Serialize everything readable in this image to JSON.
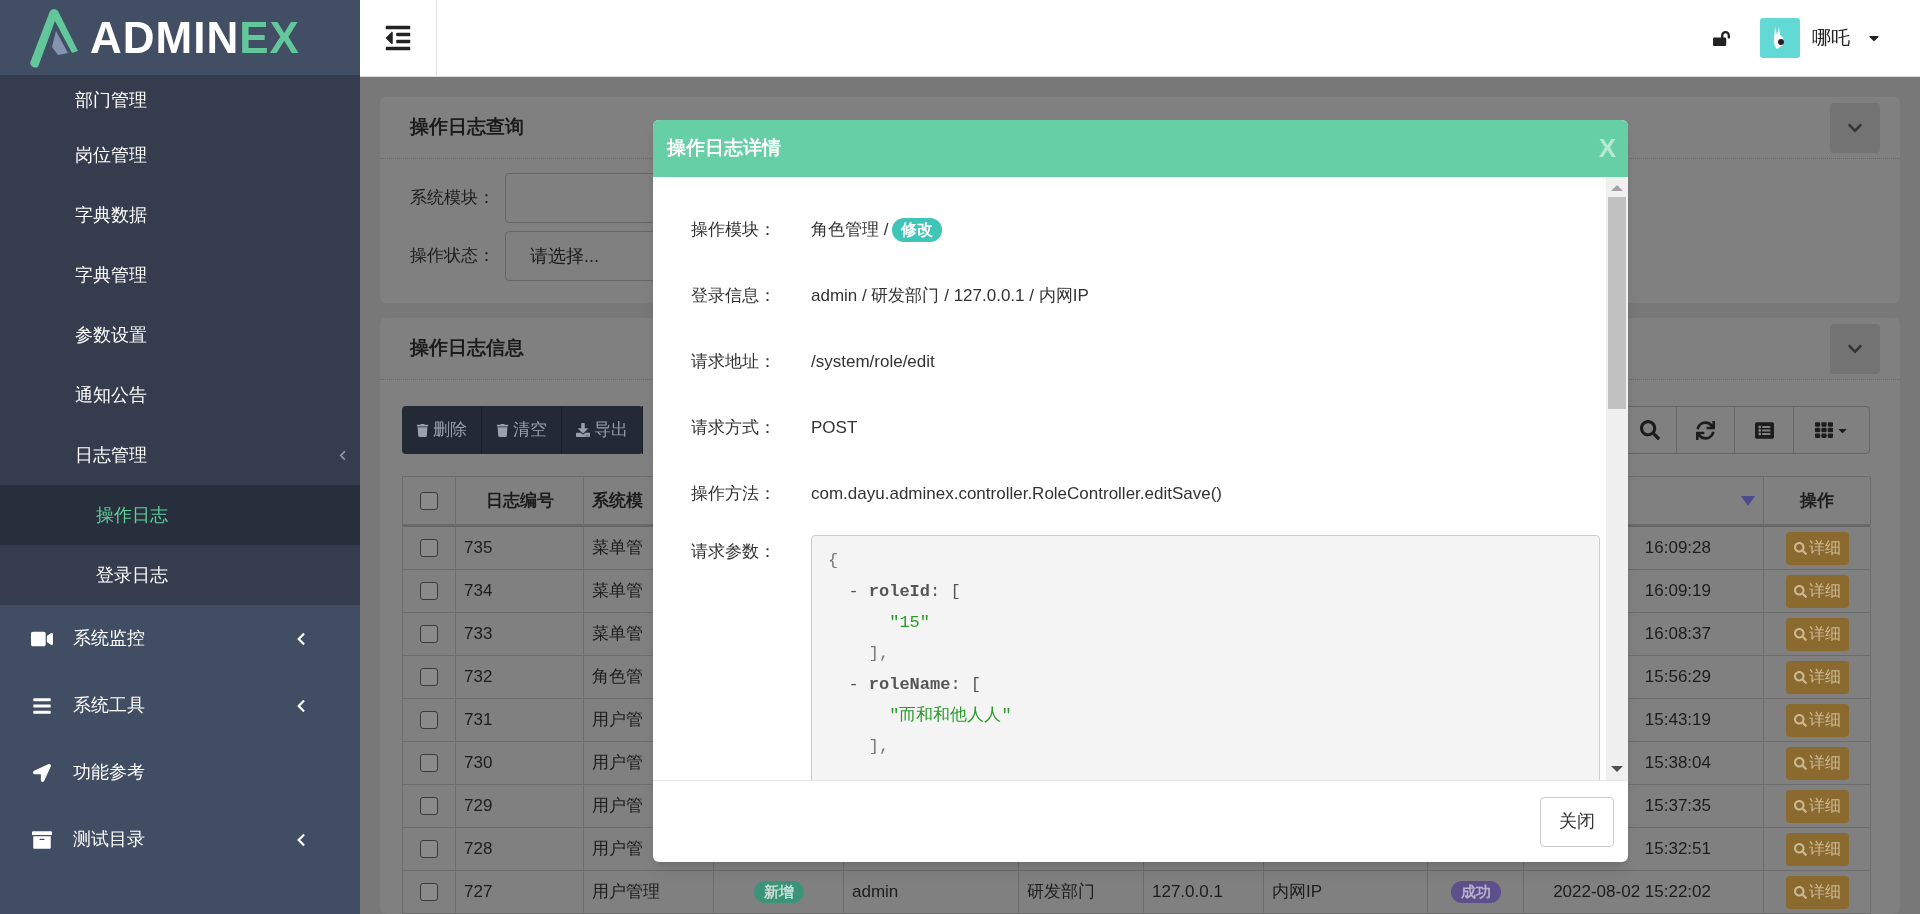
{
  "logo": {
    "text_main": "ADMIN",
    "text_accent": "EX"
  },
  "header": {
    "username": "哪吒"
  },
  "sidebar": {
    "items": [
      {
        "label": "部门管理",
        "selected": false
      },
      {
        "label": "岗位管理",
        "selected": false
      },
      {
        "label": "字典数据",
        "selected": false
      },
      {
        "label": "字典管理",
        "selected": false
      },
      {
        "label": "参数设置",
        "selected": false
      },
      {
        "label": "通知公告",
        "selected": false
      },
      {
        "label": "日志管理",
        "selected": false,
        "expanded": true,
        "children": [
          {
            "label": "操作日志",
            "selected": true
          },
          {
            "label": "登录日志",
            "selected": false
          }
        ]
      }
    ],
    "groups": [
      {
        "label": "系统监控",
        "expanded": false
      },
      {
        "label": "系统工具",
        "expanded": false
      },
      {
        "label": "功能参考"
      },
      {
        "label": "测试目录",
        "expanded": false
      }
    ]
  },
  "query_panel": {
    "title": "操作日志查询",
    "fields": [
      {
        "label": "系统模块：",
        "kind": "input"
      },
      {
        "label": "操作状态：",
        "kind": "select",
        "value": "请选择..."
      }
    ]
  },
  "list_panel": {
    "title": "操作日志信息",
    "actions": [
      "删除",
      "清空",
      "导出"
    ],
    "table": {
      "header": {
        "checked": false,
        "id": "日志编号",
        "module": "系统模",
        "action": "操作"
      },
      "rows": [
        {
          "checked": false,
          "id": "735",
          "module": "菜单管",
          "time": "16:09:28",
          "action": "详细"
        },
        {
          "checked": false,
          "id": "734",
          "module": "菜单管",
          "time": "16:09:19",
          "action": "详细"
        },
        {
          "checked": false,
          "id": "733",
          "module": "菜单管",
          "time": "16:08:37",
          "action": "详细"
        },
        {
          "checked": false,
          "id": "732",
          "module": "角色管",
          "time": "15:56:29",
          "action": "详细"
        },
        {
          "checked": false,
          "id": "731",
          "module": "用户管",
          "time": "15:43:19",
          "action": "详细"
        },
        {
          "checked": false,
          "id": "730",
          "module": "用户管",
          "time": "15:38:04",
          "action": "详细"
        },
        {
          "checked": false,
          "id": "729",
          "module": "用户管",
          "time": "15:37:35",
          "action": "详细"
        },
        {
          "checked": false,
          "id": "728",
          "module": "用户管",
          "time": "15:32:51",
          "action": "详细"
        },
        {
          "checked": false,
          "id": "727",
          "module": "用户管理",
          "type": {
            "text": "新增",
            "color": "#3a9478"
          },
          "user": "admin",
          "dept": "研发部门",
          "ip": "127.0.0.1",
          "location": "内网IP",
          "status": {
            "text": "成功",
            "color": "#5b4f8c"
          },
          "time": "2022-08-02 15:22:02",
          "action": "详细"
        }
      ]
    }
  },
  "modal": {
    "title": "操作日志详情",
    "close_label": "X",
    "fields": [
      {
        "label": "操作模块：",
        "value": "角色管理 /",
        "badge": "修改"
      },
      {
        "label": "登录信息：",
        "value": "admin / 研发部门 / 127.0.0.1 / 内网IP"
      },
      {
        "label": "请求地址：",
        "value": "/system/role/edit"
      },
      {
        "label": "请求方式：",
        "value": "POST"
      },
      {
        "label": "操作方法：",
        "value": "com.dayu.adminex.controller.RoleController.editSave()"
      }
    ],
    "params": {
      "label": "请求参数：",
      "lines": [
        {
          "kind": "punct",
          "text": "{"
        },
        {
          "kind": "key",
          "text": "  - **roleId**: ["
        },
        {
          "kind": "string",
          "text": "      \"15\""
        },
        {
          "kind": "punct",
          "text": "    ],"
        },
        {
          "kind": "key",
          "text": "  - **roleName**: ["
        },
        {
          "kind": "string",
          "text": "      \"而和和他人人\""
        },
        {
          "kind": "punct",
          "text": "    ],"
        }
      ]
    },
    "footer_button": "关闭"
  }
}
